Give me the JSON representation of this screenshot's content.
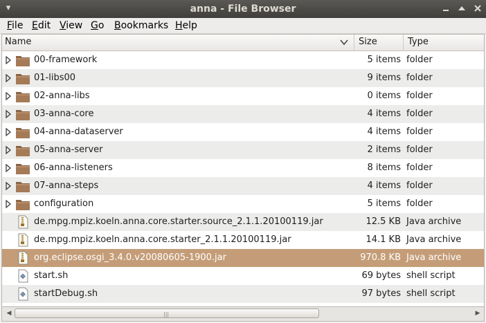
{
  "window": {
    "title": "anna - File Browser"
  },
  "menubar": {
    "items": [
      {
        "label": "File",
        "mnemonic": "F",
        "rest": "ile"
      },
      {
        "label": "Edit",
        "mnemonic": "E",
        "rest": "dit"
      },
      {
        "label": "View",
        "mnemonic": "V",
        "rest": "iew"
      },
      {
        "label": "Go",
        "mnemonic": "G",
        "rest": "o"
      },
      {
        "label": "Bookmarks",
        "mnemonic": "B",
        "rest": "ookmarks"
      },
      {
        "label": "Help",
        "mnemonic": "H",
        "rest": "elp"
      }
    ]
  },
  "columns": {
    "name": "Name",
    "size": "Size",
    "type": "Type"
  },
  "files": [
    {
      "name": "00-framework",
      "size": "5 items",
      "type": "folder",
      "kind": "folder-icon"
    },
    {
      "name": "01-libs00",
      "size": "9 items",
      "type": "folder",
      "kind": "folder-icon"
    },
    {
      "name": "02-anna-libs",
      "size": "0 items",
      "type": "folder",
      "kind": "folder-icon"
    },
    {
      "name": "03-anna-core",
      "size": "4 items",
      "type": "folder",
      "kind": "folder-icon"
    },
    {
      "name": "04-anna-dataserver",
      "size": "4 items",
      "type": "folder",
      "kind": "folder-icon"
    },
    {
      "name": "05-anna-server",
      "size": "2 items",
      "type": "folder",
      "kind": "folder-icon"
    },
    {
      "name": "06-anna-listeners",
      "size": "8 items",
      "type": "folder",
      "kind": "folder-icon"
    },
    {
      "name": "07-anna-steps",
      "size": "4 items",
      "type": "folder",
      "kind": "folder-icon"
    },
    {
      "name": "configuration",
      "size": "5 items",
      "type": "folder",
      "kind": "folder-icon"
    },
    {
      "name": "de.mpg.mpiz.koeln.anna.core.starter.source_2.1.1.20100119.jar",
      "size": "12.5 KB",
      "type": "Java archive",
      "kind": "archive-icon"
    },
    {
      "name": "de.mpg.mpiz.koeln.anna.core.starter_2.1.1.20100119.jar",
      "size": "14.1 KB",
      "type": "Java archive",
      "kind": "archive-icon"
    },
    {
      "name": "org.eclipse.osgi_3.4.0.v20080605-1900.jar",
      "size": "970.8 KB",
      "type": "Java archive",
      "kind": "archive-icon",
      "selected": true
    },
    {
      "name": "start.sh",
      "size": "69 bytes",
      "type": "shell script",
      "kind": "script-icon"
    },
    {
      "name": "startDebug.sh",
      "size": "97 bytes",
      "type": "shell script",
      "kind": "script-icon"
    }
  ],
  "colors": {
    "selection": "#c49d78",
    "folder": "#a47a57",
    "titlebar": "#3f3e3a"
  }
}
